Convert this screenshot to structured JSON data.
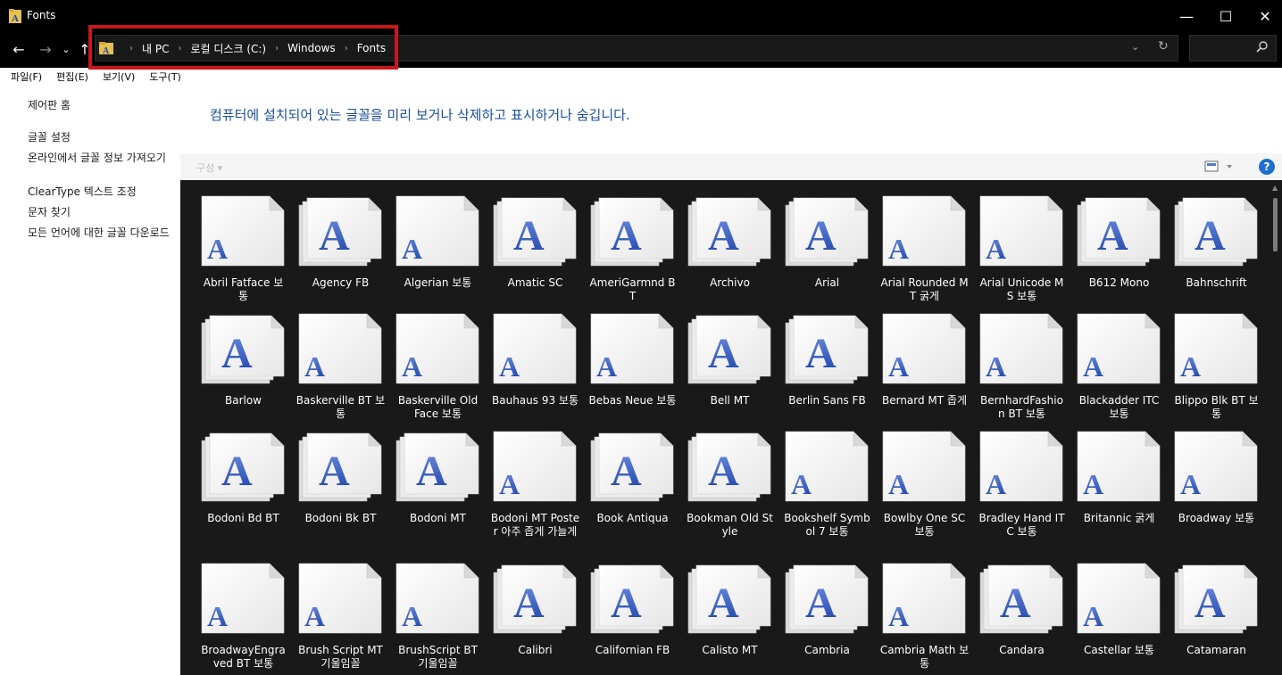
{
  "window": {
    "title": "Fonts",
    "minimize": "—",
    "maximize": "☐",
    "close": "✕"
  },
  "nav": {
    "back": "←",
    "forward": "→",
    "recent": "⌄",
    "up": "↑"
  },
  "address": {
    "crumbs": [
      "내 PC",
      "로컬 디스크 (C:)",
      "Windows",
      "Fonts"
    ],
    "separator": "›",
    "dropdown": "⌄",
    "refresh": "↻",
    "highlight_color": "#c8161d"
  },
  "search": {
    "icon": "search-icon"
  },
  "menu": [
    "파일(F)",
    "편집(E)",
    "보기(V)",
    "도구(T)"
  ],
  "left_pane": {
    "items": [
      "제어판 홈",
      "글꼴 설정",
      "온라인에서 글꼴 정보 가져오기",
      "ClearType 텍스트 조정",
      "문자 찾기",
      "모든 언어에 대한 글꼴 다운로드"
    ]
  },
  "main": {
    "headline": "컴퓨터에 설치되어 있는 글꼴을 미리 보거나 삭제하고 표시하거나 숨깁니다.",
    "organize": "구성",
    "help": "?",
    "accent_color": "#1c4f9c"
  },
  "fonts": [
    {
      "name": "Abril Fatface 보통",
      "stacked": false
    },
    {
      "name": "Agency FB",
      "stacked": true
    },
    {
      "name": "Algerian 보통",
      "stacked": false
    },
    {
      "name": "Amatic SC",
      "stacked": true
    },
    {
      "name": "AmeriGarmnd BT",
      "stacked": true
    },
    {
      "name": "Archivo",
      "stacked": true
    },
    {
      "name": "Arial",
      "stacked": true
    },
    {
      "name": "Arial Rounded MT 굵게",
      "stacked": false
    },
    {
      "name": "Arial Unicode MS 보통",
      "stacked": false
    },
    {
      "name": "B612 Mono",
      "stacked": true
    },
    {
      "name": "Bahnschrift",
      "stacked": true
    },
    {
      "name": "Barlow",
      "stacked": true
    },
    {
      "name": "Baskerville BT 보통",
      "stacked": false
    },
    {
      "name": "Baskerville Old Face 보통",
      "stacked": false
    },
    {
      "name": "Bauhaus 93 보통",
      "stacked": false
    },
    {
      "name": "Bebas Neue 보통",
      "stacked": false
    },
    {
      "name": "Bell MT",
      "stacked": true
    },
    {
      "name": "Berlin Sans FB",
      "stacked": true
    },
    {
      "name": "Bernard MT 좁게",
      "stacked": false
    },
    {
      "name": "BernhardFashion BT 보통",
      "stacked": false
    },
    {
      "name": "Blackadder ITC 보통",
      "stacked": false
    },
    {
      "name": "Blippo Blk BT 보통",
      "stacked": false
    },
    {
      "name": "Bodoni Bd BT",
      "stacked": true
    },
    {
      "name": "Bodoni Bk BT",
      "stacked": true
    },
    {
      "name": "Bodoni MT",
      "stacked": true
    },
    {
      "name": "Bodoni MT Poster 아주 좁게 가늘게",
      "stacked": false
    },
    {
      "name": "Book Antiqua",
      "stacked": true
    },
    {
      "name": "Bookman Old Style",
      "stacked": true
    },
    {
      "name": "Bookshelf Symbol 7 보통",
      "stacked": false
    },
    {
      "name": "Bowlby One SC 보통",
      "stacked": false
    },
    {
      "name": "Bradley Hand ITC 보통",
      "stacked": false
    },
    {
      "name": "Britannic 굵게",
      "stacked": false
    },
    {
      "name": "Broadway 보통",
      "stacked": false
    },
    {
      "name": "BroadwayEngraved BT 보통",
      "stacked": false
    },
    {
      "name": "Brush Script MT 기울임꼴",
      "stacked": false
    },
    {
      "name": "BrushScript BT 기울임꼴",
      "stacked": false
    },
    {
      "name": "Calibri",
      "stacked": true
    },
    {
      "name": "Californian FB",
      "stacked": true
    },
    {
      "name": "Calisto MT",
      "stacked": true
    },
    {
      "name": "Cambria",
      "stacked": true
    },
    {
      "name": "Cambria Math 보통",
      "stacked": false
    },
    {
      "name": "Candara",
      "stacked": true
    },
    {
      "name": "Castellar 보통",
      "stacked": false
    },
    {
      "name": "Catamaran",
      "stacked": true
    }
  ]
}
